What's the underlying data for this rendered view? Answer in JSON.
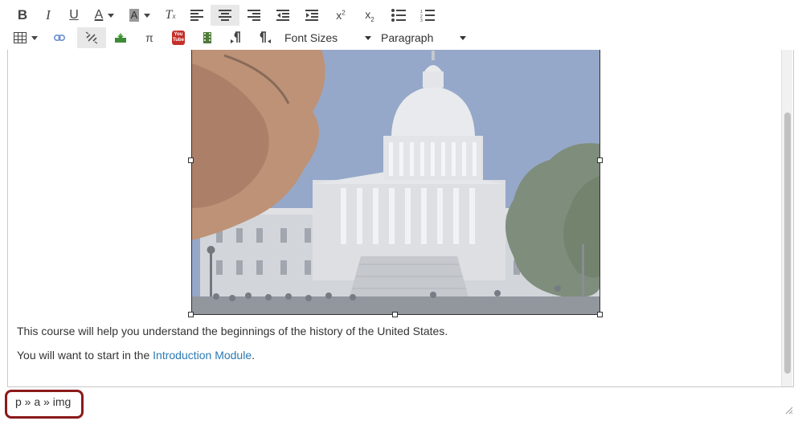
{
  "toolbar": {
    "row1": [
      {
        "name": "bold",
        "icon": "bold-icon"
      },
      {
        "name": "italic",
        "icon": "italic-icon"
      },
      {
        "name": "underline",
        "icon": "underline-icon"
      },
      {
        "name": "text-color",
        "icon": "text-color-icon"
      },
      {
        "name": "background-color",
        "icon": "background-color-icon"
      },
      {
        "name": "clear-formatting",
        "icon": "clear-formatting-icon"
      },
      {
        "name": "align-left",
        "icon": "align-left-icon"
      },
      {
        "name": "align-center",
        "icon": "align-center-icon",
        "active": true
      },
      {
        "name": "align-right",
        "icon": "align-right-icon"
      },
      {
        "name": "outdent",
        "icon": "outdent-icon"
      },
      {
        "name": "indent",
        "icon": "indent-icon"
      },
      {
        "name": "superscript",
        "icon": "superscript-icon"
      },
      {
        "name": "subscript",
        "icon": "subscript-icon"
      },
      {
        "name": "bullet-list",
        "icon": "bullet-list-icon"
      },
      {
        "name": "numbered-list",
        "icon": "numbered-list-icon"
      }
    ],
    "row2": [
      {
        "name": "table",
        "icon": "table-icon"
      },
      {
        "name": "insert-link",
        "icon": "link-icon"
      },
      {
        "name": "unlink",
        "icon": "unlink-icon",
        "active": true
      },
      {
        "name": "embed-image",
        "icon": "image-icon"
      },
      {
        "name": "math-equation",
        "icon": "pi-icon"
      },
      {
        "name": "youtube-embed",
        "icon": "youtube-icon"
      },
      {
        "name": "media-upload",
        "icon": "media-icon"
      },
      {
        "name": "ltr-paragraph",
        "icon": "ltr-paragraph-icon"
      },
      {
        "name": "rtl-paragraph",
        "icon": "rtl-paragraph-icon"
      }
    ],
    "font_sizes_label": "Font Sizes",
    "paragraph_label": "Paragraph",
    "youtube_icon_text": [
      "You",
      "Tube"
    ],
    "superscript_label": "x²",
    "subscript_label": "x₂",
    "pi_label": "π"
  },
  "editor": {
    "line1": "This course will help you understand the beginnings of the history of the United States.",
    "line2_prefix": "You will want to start in the ",
    "line2_link": "Introduction Module",
    "line2_suffix": "."
  },
  "statusbar": {
    "element_path": "p » a » img"
  },
  "colors": {
    "link": "#2a7ab3",
    "highlight_border": "#8b1a1a",
    "active_button": "#e8e8e8"
  }
}
